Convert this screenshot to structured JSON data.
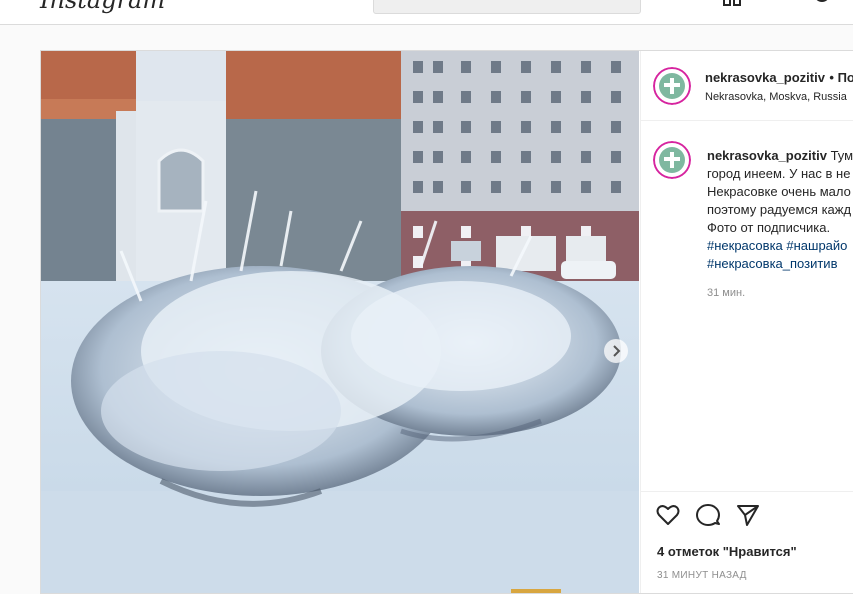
{
  "topbar": {
    "logo_text": "Instagram",
    "search_placeholder": ""
  },
  "post": {
    "username": "nekrasovka_pozitiv",
    "header_suffix": "• По",
    "location": "Nekrasovka, Moskva, Russia",
    "caption_lines": [
      "Тум",
      "город инеем. У нас в не",
      "Некрасовке очень мало",
      "поэтому радуемся кажд",
      "Фото от подписчика."
    ],
    "hashtags_line1": "#некрасовка #нашрайо",
    "hashtags_line2": "#некрасовка_позитив",
    "caption_time": "31 мин.",
    "likes_text": "4 отметок \"Нравится\"",
    "time_ago": "31 МИНУТ НАЗАД"
  },
  "colors": {
    "hashtag": "#00376b",
    "muted": "#8e8e8e",
    "border": "#dbdbdb"
  },
  "icons": [
    "heart-icon",
    "comment-icon",
    "share-icon",
    "chevron-right-icon",
    "search-icon"
  ]
}
